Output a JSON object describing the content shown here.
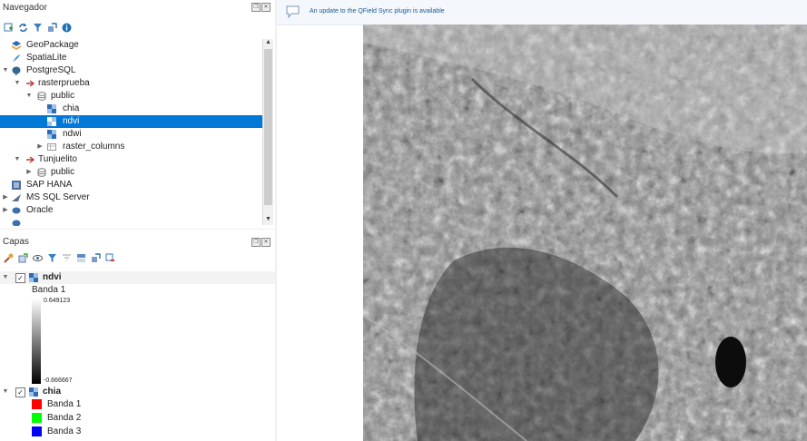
{
  "navigator": {
    "title": "Navegador",
    "items": [
      {
        "label": "GeoPackage"
      },
      {
        "label": "SpatiaLite"
      },
      {
        "label": "PostgreSQL"
      },
      {
        "label": "rasterprueba"
      },
      {
        "label": "public"
      },
      {
        "label": "chia"
      },
      {
        "label": "ndvi"
      },
      {
        "label": "ndwi"
      },
      {
        "label": "raster_columns"
      },
      {
        "label": "Tunjuelito"
      },
      {
        "label": "public"
      },
      {
        "label": "SAP HANA"
      },
      {
        "label": "MS SQL Server"
      },
      {
        "label": "Oracle"
      }
    ]
  },
  "layers": {
    "title": "Capas",
    "ndvi": {
      "name": "ndvi",
      "band": "Banda 1",
      "max": "0.649123",
      "min": "-0.666667"
    },
    "chia": {
      "name": "chia",
      "bands": [
        {
          "label": "Banda 1",
          "color": "#ff0000"
        },
        {
          "label": "Banda 2",
          "color": "#00ff00"
        },
        {
          "label": "Banda 3",
          "color": "#0000ff"
        }
      ]
    }
  },
  "message_bar": {
    "text": "An update to the QField Sync plugin is available"
  },
  "colors": {
    "selection": "#0078d7",
    "message_text": "#1a5a94"
  }
}
